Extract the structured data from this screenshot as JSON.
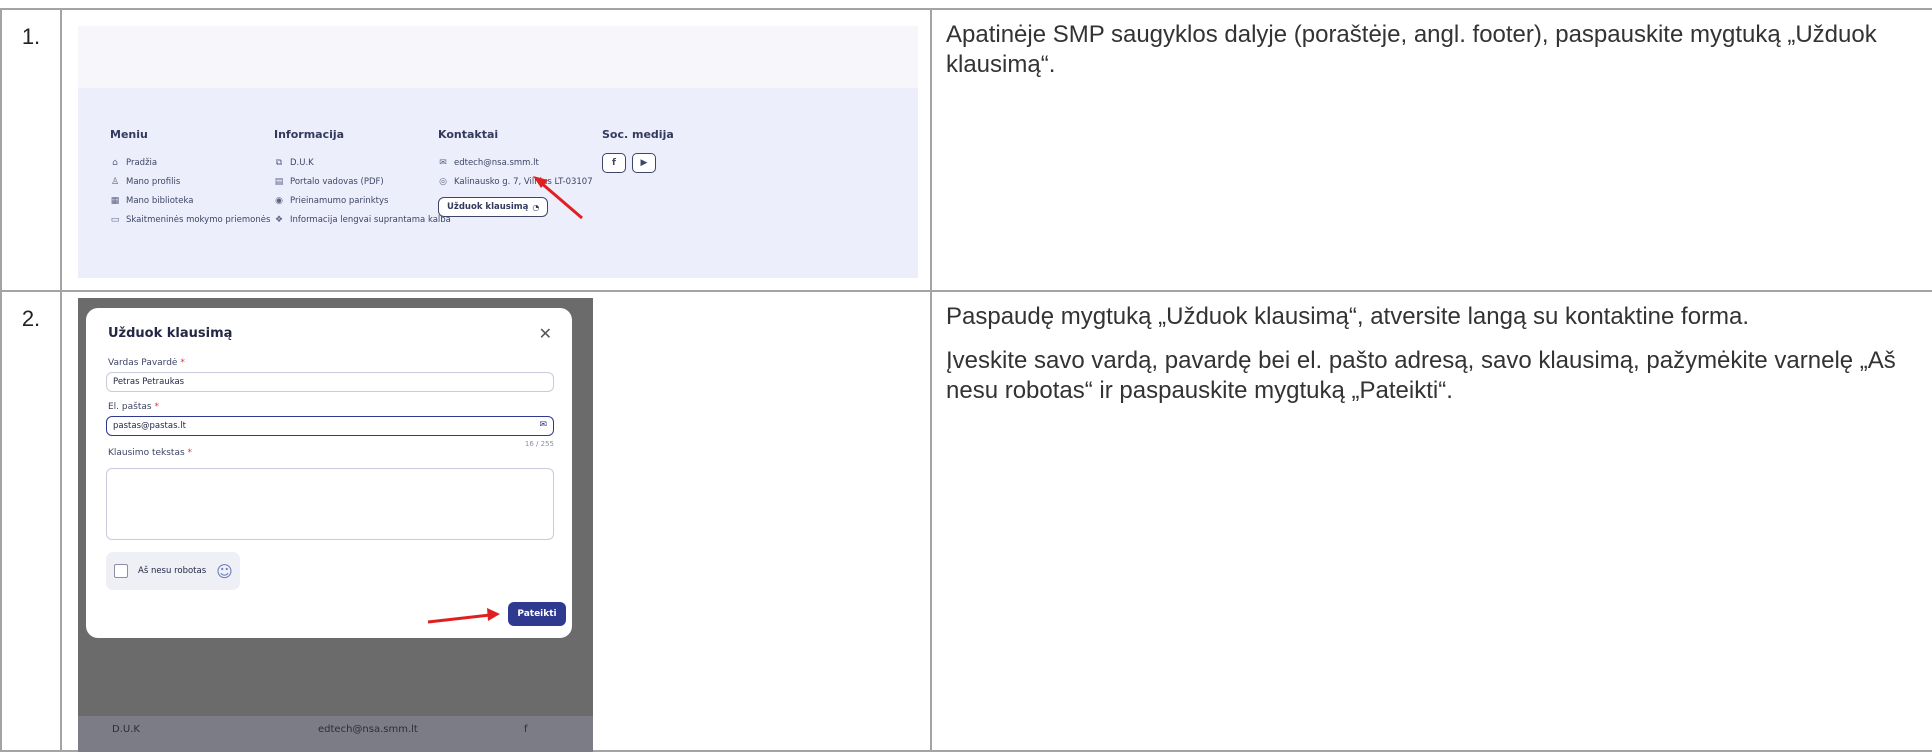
{
  "rows": [
    {
      "number": "1.",
      "description": [
        "Apatinėje SMP saugyklos dalyje (poraštėje, angl. footer), paspauskite mygtuką „Užduok klausimą“."
      ]
    },
    {
      "number": "2.",
      "description": [
        "Paspaudę mygtuką „Užduok klausimą“, atversite langą su kontaktine forma.",
        "Įveskite savo vardą, pavardę bei el. pašto adresą, savo klausimą, pažymėkite varnelę „Aš nesu robotas“ ir paspauskite mygtuką „Pateikti“."
      ]
    }
  ],
  "footer": {
    "menu": {
      "title": "Meniu",
      "items": [
        {
          "label": "Pradžia",
          "icon": "home-icon"
        },
        {
          "label": "Mano profilis",
          "icon": "user-icon"
        },
        {
          "label": "Mano biblioteka",
          "icon": "library-icon"
        },
        {
          "label": "Skaitmeninės mokymo priemonės",
          "icon": "monitor-icon"
        }
      ]
    },
    "info": {
      "title": "Informacija",
      "items": [
        {
          "label": "D.U.K",
          "icon": "faq-icon"
        },
        {
          "label": "Portalo vadovas (PDF)",
          "icon": "document-icon"
        },
        {
          "label": "Prieinamumo parinktys",
          "icon": "accessibility-icon"
        },
        {
          "label": "Informacija lengvai suprantama kalba",
          "icon": "easy-read-icon"
        }
      ]
    },
    "contacts": {
      "title": "Kontaktai",
      "email": "edtech@nsa.smm.lt",
      "address": "Kalinausko g. 7, Vilnius LT-03107",
      "ask_button": "Užduok klausimą"
    },
    "social": {
      "title": "Soc. medija",
      "facebook": "f",
      "youtube": "▶"
    }
  },
  "modal": {
    "title": "Užduok klausimą",
    "close": "✕",
    "name_label": "Vardas Pavardė",
    "name_value": "Petras Petraukas",
    "email_label": "El. paštas",
    "email_value": "pastas@pastas.lt",
    "counter": "16 / 255",
    "question_label": "Klausimo tekstas",
    "required_mark": "*",
    "captcha_label": "Aš nesu robotas",
    "submit_label": "Pateikti",
    "bg_faq": "D.U.K",
    "bg_email": "edtech@nsa.smm.lt",
    "bg_social": "f"
  },
  "colors": {
    "border": "#a3a3a3",
    "accent": "#2f3a8f",
    "arrow": "#e02020"
  }
}
